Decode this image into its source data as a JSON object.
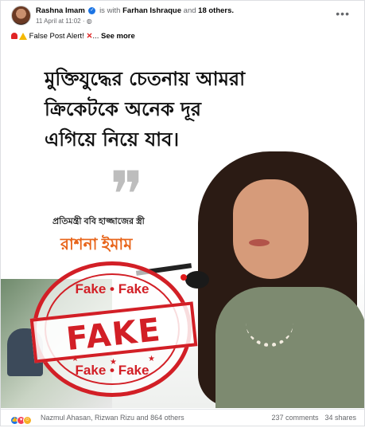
{
  "post": {
    "author": "Rashna Imam",
    "with_text": "is with",
    "tagged_person": "Farhan Ishraque",
    "and_text": "and",
    "others": "18 others.",
    "timestamp": "11 April at 11:02",
    "audience_icon": "globe-icon",
    "caption": "False Post Alert!",
    "see_more": "See more"
  },
  "image": {
    "headline_line1": "মুক্তিযুদ্ধের চেতনায় আমরা",
    "headline_line2": "ক্রিকেটকে অনেক দূর",
    "headline_line3": "এগিয়ে নিয়ে যাব।",
    "quote_glyph": "❞",
    "subtitle": "প্রতিমন্ত্রী ববি হাজ্জাজের স্ত্রী",
    "name": "রাশনা ইমাম",
    "stamp_top": "Fake • Fake",
    "stamp_word": "FAKE",
    "stamp_bottom": "Fake • Fake"
  },
  "footer": {
    "reactions": [
      "like",
      "love",
      "care"
    ],
    "reactors": "Nazmul Ahasan, Rizwan Rizu and 864 others",
    "comments": "237 comments",
    "shares": "34 shares"
  },
  "colors": {
    "brand_blue": "#1b74e4",
    "stamp_red": "#d21f26",
    "name_orange": "#e8651b"
  }
}
